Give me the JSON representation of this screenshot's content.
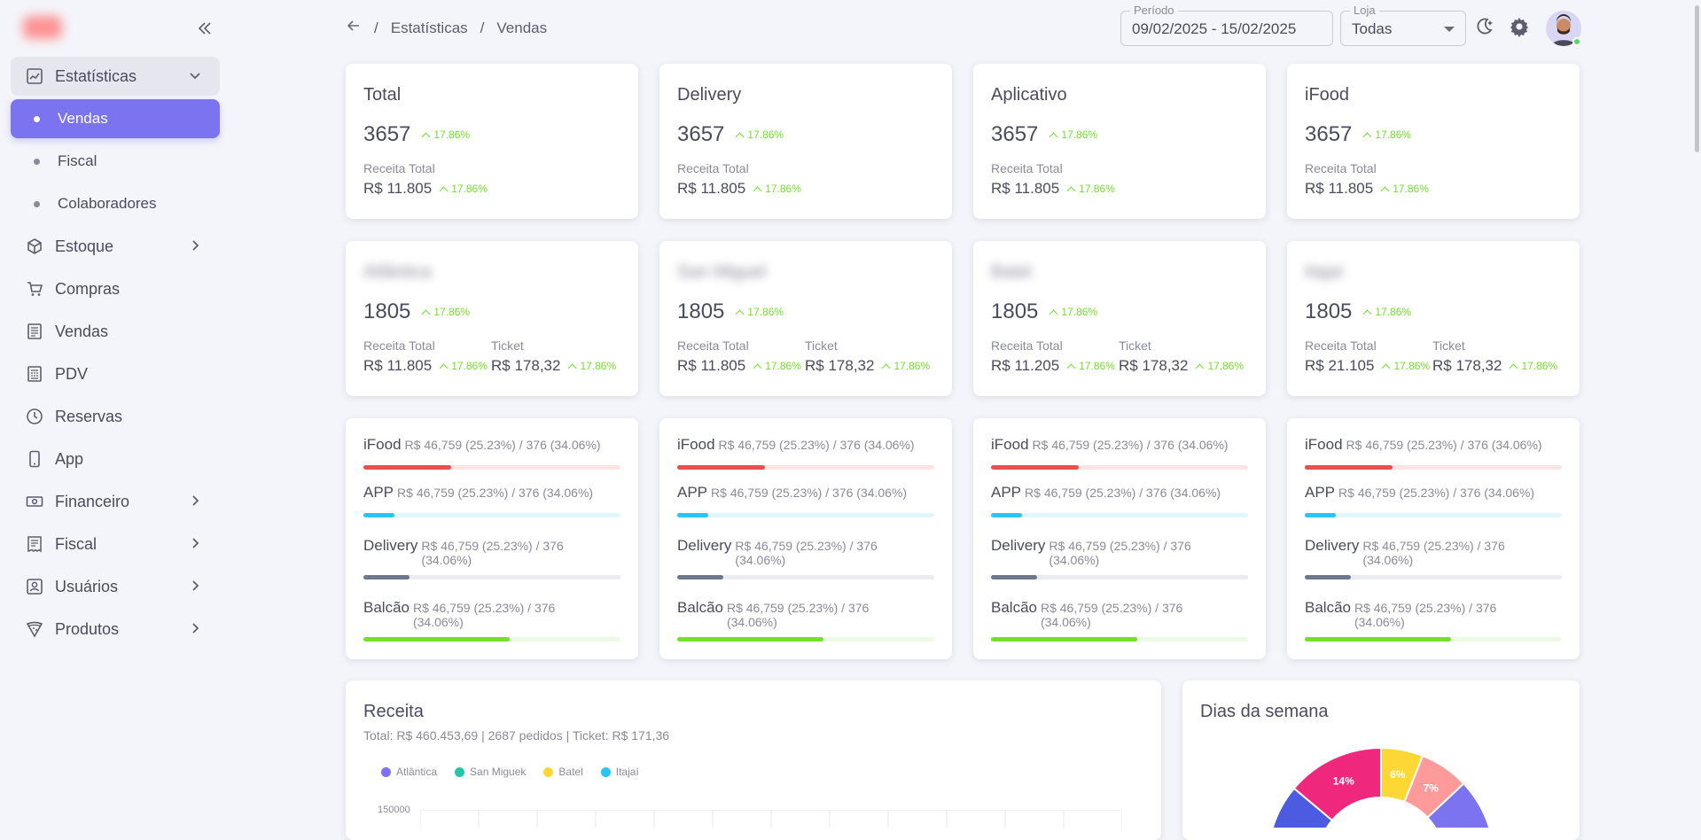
{
  "sidebar": {
    "items": [
      {
        "label": "Estatísticas",
        "icon": "chart-line-icon",
        "state": "open"
      },
      {
        "label": "Vendas",
        "sub": true,
        "state": "active"
      },
      {
        "label": "Fiscal",
        "sub": true
      },
      {
        "label": "Colaboradores",
        "sub": true
      },
      {
        "label": "Estoque",
        "icon": "box-icon",
        "chevron": true
      },
      {
        "label": "Compras",
        "icon": "cart-icon"
      },
      {
        "label": "Vendas",
        "icon": "receipt-icon"
      },
      {
        "label": "PDV",
        "icon": "register-icon"
      },
      {
        "label": "Reservas",
        "icon": "clock-icon"
      },
      {
        "label": "App",
        "icon": "phone-icon"
      },
      {
        "label": "Financeiro",
        "icon": "cash-icon",
        "chevron": true
      },
      {
        "label": "Fiscal",
        "icon": "invoice-icon",
        "chevron": true
      },
      {
        "label": "Usuários",
        "icon": "user-icon",
        "chevron": true
      },
      {
        "label": "Produtos",
        "icon": "pizza-icon",
        "chevron": true
      }
    ]
  },
  "header": {
    "breadcrumb": [
      "Estatísticas",
      "Vendas"
    ],
    "sep": "/",
    "period_label": "Período",
    "period_value": "09/02/2025 - 15/02/2025",
    "store_label": "Loja",
    "store_value": "Todas"
  },
  "summary_cards": [
    {
      "title": "Total",
      "count": "3657",
      "count_pct": "17.86%",
      "rev_label": "Receita Total",
      "revenue": "R$ 11.805",
      "rev_pct": "17.86%"
    },
    {
      "title": "Delivery",
      "count": "3657",
      "count_pct": "17.86%",
      "rev_label": "Receita Total",
      "revenue": "R$ 11.805",
      "rev_pct": "17.86%"
    },
    {
      "title": "Aplicativo",
      "count": "3657",
      "count_pct": "17.86%",
      "rev_label": "Receita Total",
      "revenue": "R$ 11.805",
      "rev_pct": "17.86%"
    },
    {
      "title": "iFood",
      "count": "3657",
      "count_pct": "17.86%",
      "rev_label": "Receita Total",
      "revenue": "R$ 11.805",
      "rev_pct": "17.86%"
    }
  ],
  "store_cards": [
    {
      "title": "Atlântica",
      "count": "1805",
      "count_pct": "17.86%",
      "rev_label": "Receita Total",
      "revenue": "R$ 11.805",
      "rev_pct": "17.86%",
      "ticket_label": "Ticket",
      "ticket": "R$ 178,32",
      "ticket_pct": "17.86%"
    },
    {
      "title": "San Miguel",
      "count": "1805",
      "count_pct": "17.86%",
      "rev_label": "Receita Total",
      "revenue": "R$ 11.805",
      "rev_pct": "17.86%",
      "ticket_label": "Ticket",
      "ticket": "R$ 178,32",
      "ticket_pct": "17.86%"
    },
    {
      "title": "Batel",
      "count": "1805",
      "count_pct": "17.86%",
      "rev_label": "Receita Total",
      "revenue": "R$ 11.205",
      "rev_pct": "17.86%",
      "ticket_label": "Ticket",
      "ticket": "R$ 178,32",
      "ticket_pct": "17.86%"
    },
    {
      "title": "Itajaí",
      "count": "1805",
      "count_pct": "17.86%",
      "rev_label": "Receita Total",
      "revenue": "R$ 21.105",
      "rev_pct": "17.86%",
      "ticket_label": "Ticket",
      "ticket": "R$ 178,32",
      "ticket_pct": "17.86%"
    }
  ],
  "source_cards": [
    {
      "rows": [
        {
          "name": "iFood",
          "text": "R$ 46,759 (25.23%) / 376 (34.06%)",
          "progress": 0.34,
          "color": "#ea4f4f",
          "track": "#fde4e4"
        },
        {
          "name": "APP",
          "text": "R$ 46,759 (25.23%) / 376 (34.06%)",
          "progress": 0.12,
          "color": "#26c6f9",
          "track": "#e2f6fe"
        },
        {
          "name": "Delivery",
          "text": "R$ 46,759 (25.23%) / 376 (34.06%)",
          "progress": 0.18,
          "color": "#6d788d",
          "track": "#ebecef"
        },
        {
          "name": "Balcão",
          "text": "R$ 46,759 (25.23%) / 376 (34.06%)",
          "progress": 0.57,
          "color": "#72e128",
          "track": "#edfbe4"
        }
      ]
    },
    {
      "rows": [
        {
          "name": "iFood",
          "text": "R$ 46,759 (25.23%) / 376 (34.06%)",
          "progress": 0.34,
          "color": "#ea4f4f",
          "track": "#fde4e4"
        },
        {
          "name": "APP",
          "text": "R$ 46,759 (25.23%) / 376 (34.06%)",
          "progress": 0.12,
          "color": "#26c6f9",
          "track": "#e2f6fe"
        },
        {
          "name": "Delivery",
          "text": "R$ 46,759 (25.23%) / 376 (34.06%)",
          "progress": 0.18,
          "color": "#6d788d",
          "track": "#ebecef"
        },
        {
          "name": "Balcão",
          "text": "R$ 46,759 (25.23%) / 376 (34.06%)",
          "progress": 0.57,
          "color": "#72e128",
          "track": "#edfbe4"
        }
      ]
    },
    {
      "rows": [
        {
          "name": "iFood",
          "text": "R$ 46,759 (25.23%) / 376 (34.06%)",
          "progress": 0.34,
          "color": "#ea4f4f",
          "track": "#fde4e4"
        },
        {
          "name": "APP",
          "text": "R$ 46,759 (25.23%) / 376 (34.06%)",
          "progress": 0.12,
          "color": "#26c6f9",
          "track": "#e2f6fe"
        },
        {
          "name": "Delivery",
          "text": "R$ 46,759 (25.23%) / 376 (34.06%)",
          "progress": 0.18,
          "color": "#6d788d",
          "track": "#ebecef"
        },
        {
          "name": "Balcão",
          "text": "R$ 46,759 (25.23%) / 376 (34.06%)",
          "progress": 0.57,
          "color": "#72e128",
          "track": "#edfbe4"
        }
      ]
    },
    {
      "rows": [
        {
          "name": "iFood",
          "text": "R$ 46,759 (25.23%) / 376 (34.06%)",
          "progress": 0.34,
          "color": "#ea4f4f",
          "track": "#fde4e4"
        },
        {
          "name": "APP",
          "text": "R$ 46,759 (25.23%) / 376 (34.06%)",
          "progress": 0.12,
          "color": "#26c6f9",
          "track": "#e2f6fe"
        },
        {
          "name": "Delivery",
          "text": "R$ 46,759 (25.23%) / 376 (34.06%)",
          "progress": 0.18,
          "color": "#6d788d",
          "track": "#ebecef"
        },
        {
          "name": "Balcão",
          "text": "R$ 46,759 (25.23%) / 376 (34.06%)",
          "progress": 0.57,
          "color": "#72e128",
          "track": "#edfbe4"
        }
      ]
    }
  ],
  "revenue_chart": {
    "title": "Receita",
    "subtitle": "Total: R$ 460.453,69 | 2687 pedidos | Ticket: R$ 171,36",
    "legend": [
      {
        "name": "Atlântica",
        "color": "#7b73f0"
      },
      {
        "name": "San Miguek",
        "color": "#26c6a9"
      },
      {
        "name": "Batel",
        "color": "#fdd835"
      },
      {
        "name": "Itajaí",
        "color": "#26c6f9"
      }
    ],
    "y_tick": "150000"
  },
  "weekday_chart": {
    "title": "Dias da semana",
    "chart_data": {
      "type": "pie",
      "values_visible": [
        {
          "label": "14%",
          "value": 14,
          "color": "#f0287d"
        },
        {
          "label": "6%",
          "value": 6,
          "color": "#fdd835"
        },
        {
          "label": "7%",
          "value": 7,
          "color": "#ff9a9a"
        }
      ]
    }
  }
}
